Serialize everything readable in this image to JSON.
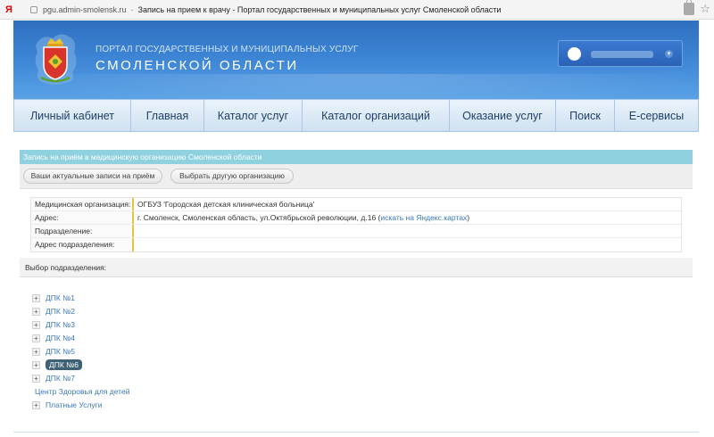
{
  "browser": {
    "ya_logo": "Я",
    "url": "pgu.admin-smolensk.ru",
    "title": "Запись на прием к врачу - Портал государственных и муниципальных услуг Смоленской области"
  },
  "header": {
    "portal_line1": "Портал государственных и муниципальных услуг",
    "portal_line2": "Смоленской области"
  },
  "nav": {
    "items": [
      {
        "label": "Личный кабинет"
      },
      {
        "label": "Главная"
      },
      {
        "label": "Каталог услуг"
      },
      {
        "label": "Каталог организаций"
      },
      {
        "label": "Оказание услуг"
      },
      {
        "label": "Поиск"
      },
      {
        "label": "Е-сервисы"
      }
    ]
  },
  "content": {
    "section_title": "Запись на приём в медицинскую организацию Смоленской области",
    "btn_current": "Ваши актуальные записи на приём",
    "btn_choose": "Выбрать другую организацию",
    "info": {
      "org_label": "Медицинская организация:",
      "org_value": "ОГБУЗ 'Городская детская клиническая больница'",
      "address_label": "Адрес:",
      "address_value": "г. Смоленск, Смоленская область, ул.Октябрьской революции, д.16 (",
      "map_link": "искать на Яндекс.картах",
      "address_close": ")",
      "division_label": "Подразделение:",
      "division_value": "",
      "division_address_label": "Адрес подразделения:",
      "division_address_value": ""
    },
    "select_label": "Выбор подразделения:",
    "tree": [
      {
        "label": "ДПК №1"
      },
      {
        "label": "ДПК №2"
      },
      {
        "label": "ДПК №3"
      },
      {
        "label": "ДПК №4"
      },
      {
        "label": "ДПК №5"
      },
      {
        "label": "ДПК №6"
      },
      {
        "label": "ДПК №7"
      },
      {
        "label": "Центр Здоровья для детей"
      },
      {
        "label": "Платные Услуги"
      }
    ]
  },
  "colors": {
    "header_blue": "#3e86d6",
    "section_head": "#8fd1df",
    "active_item": "#3d6275",
    "link": "#3a78b6",
    "accent_yellow": "#e8c438"
  }
}
